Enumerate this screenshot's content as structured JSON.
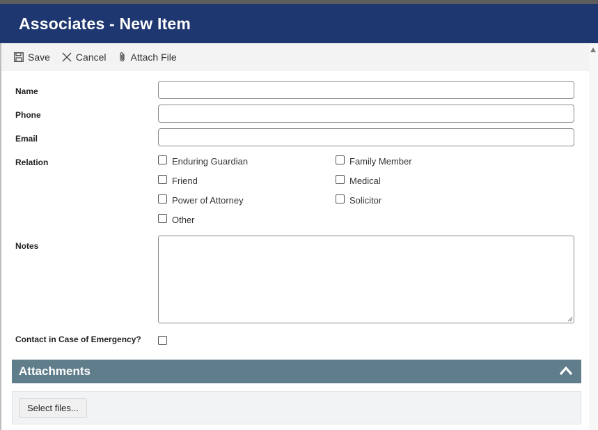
{
  "window": {
    "title": "Associates - New Item"
  },
  "toolbar": {
    "save_label": "Save",
    "cancel_label": "Cancel",
    "attach_label": "Attach File"
  },
  "form": {
    "name": {
      "label": "Name",
      "value": ""
    },
    "phone": {
      "label": "Phone",
      "value": ""
    },
    "email": {
      "label": "Email",
      "value": ""
    },
    "relation": {
      "label": "Relation",
      "options": [
        {
          "label": "Enduring Guardian",
          "checked": false
        },
        {
          "label": "Family Member",
          "checked": false
        },
        {
          "label": "Friend",
          "checked": false
        },
        {
          "label": "Medical",
          "checked": false
        },
        {
          "label": "Power of Attorney",
          "checked": false
        },
        {
          "label": "Solicitor",
          "checked": false
        },
        {
          "label": "Other",
          "checked": false
        }
      ]
    },
    "notes": {
      "label": "Notes",
      "value": ""
    },
    "emergency": {
      "label": "Contact in Case of Emergency?",
      "checked": false
    }
  },
  "attachments": {
    "title": "Attachments",
    "select_label": "Select files..."
  },
  "colors": {
    "title_bar": "#1f3770",
    "attachments_header": "#607d8b"
  }
}
